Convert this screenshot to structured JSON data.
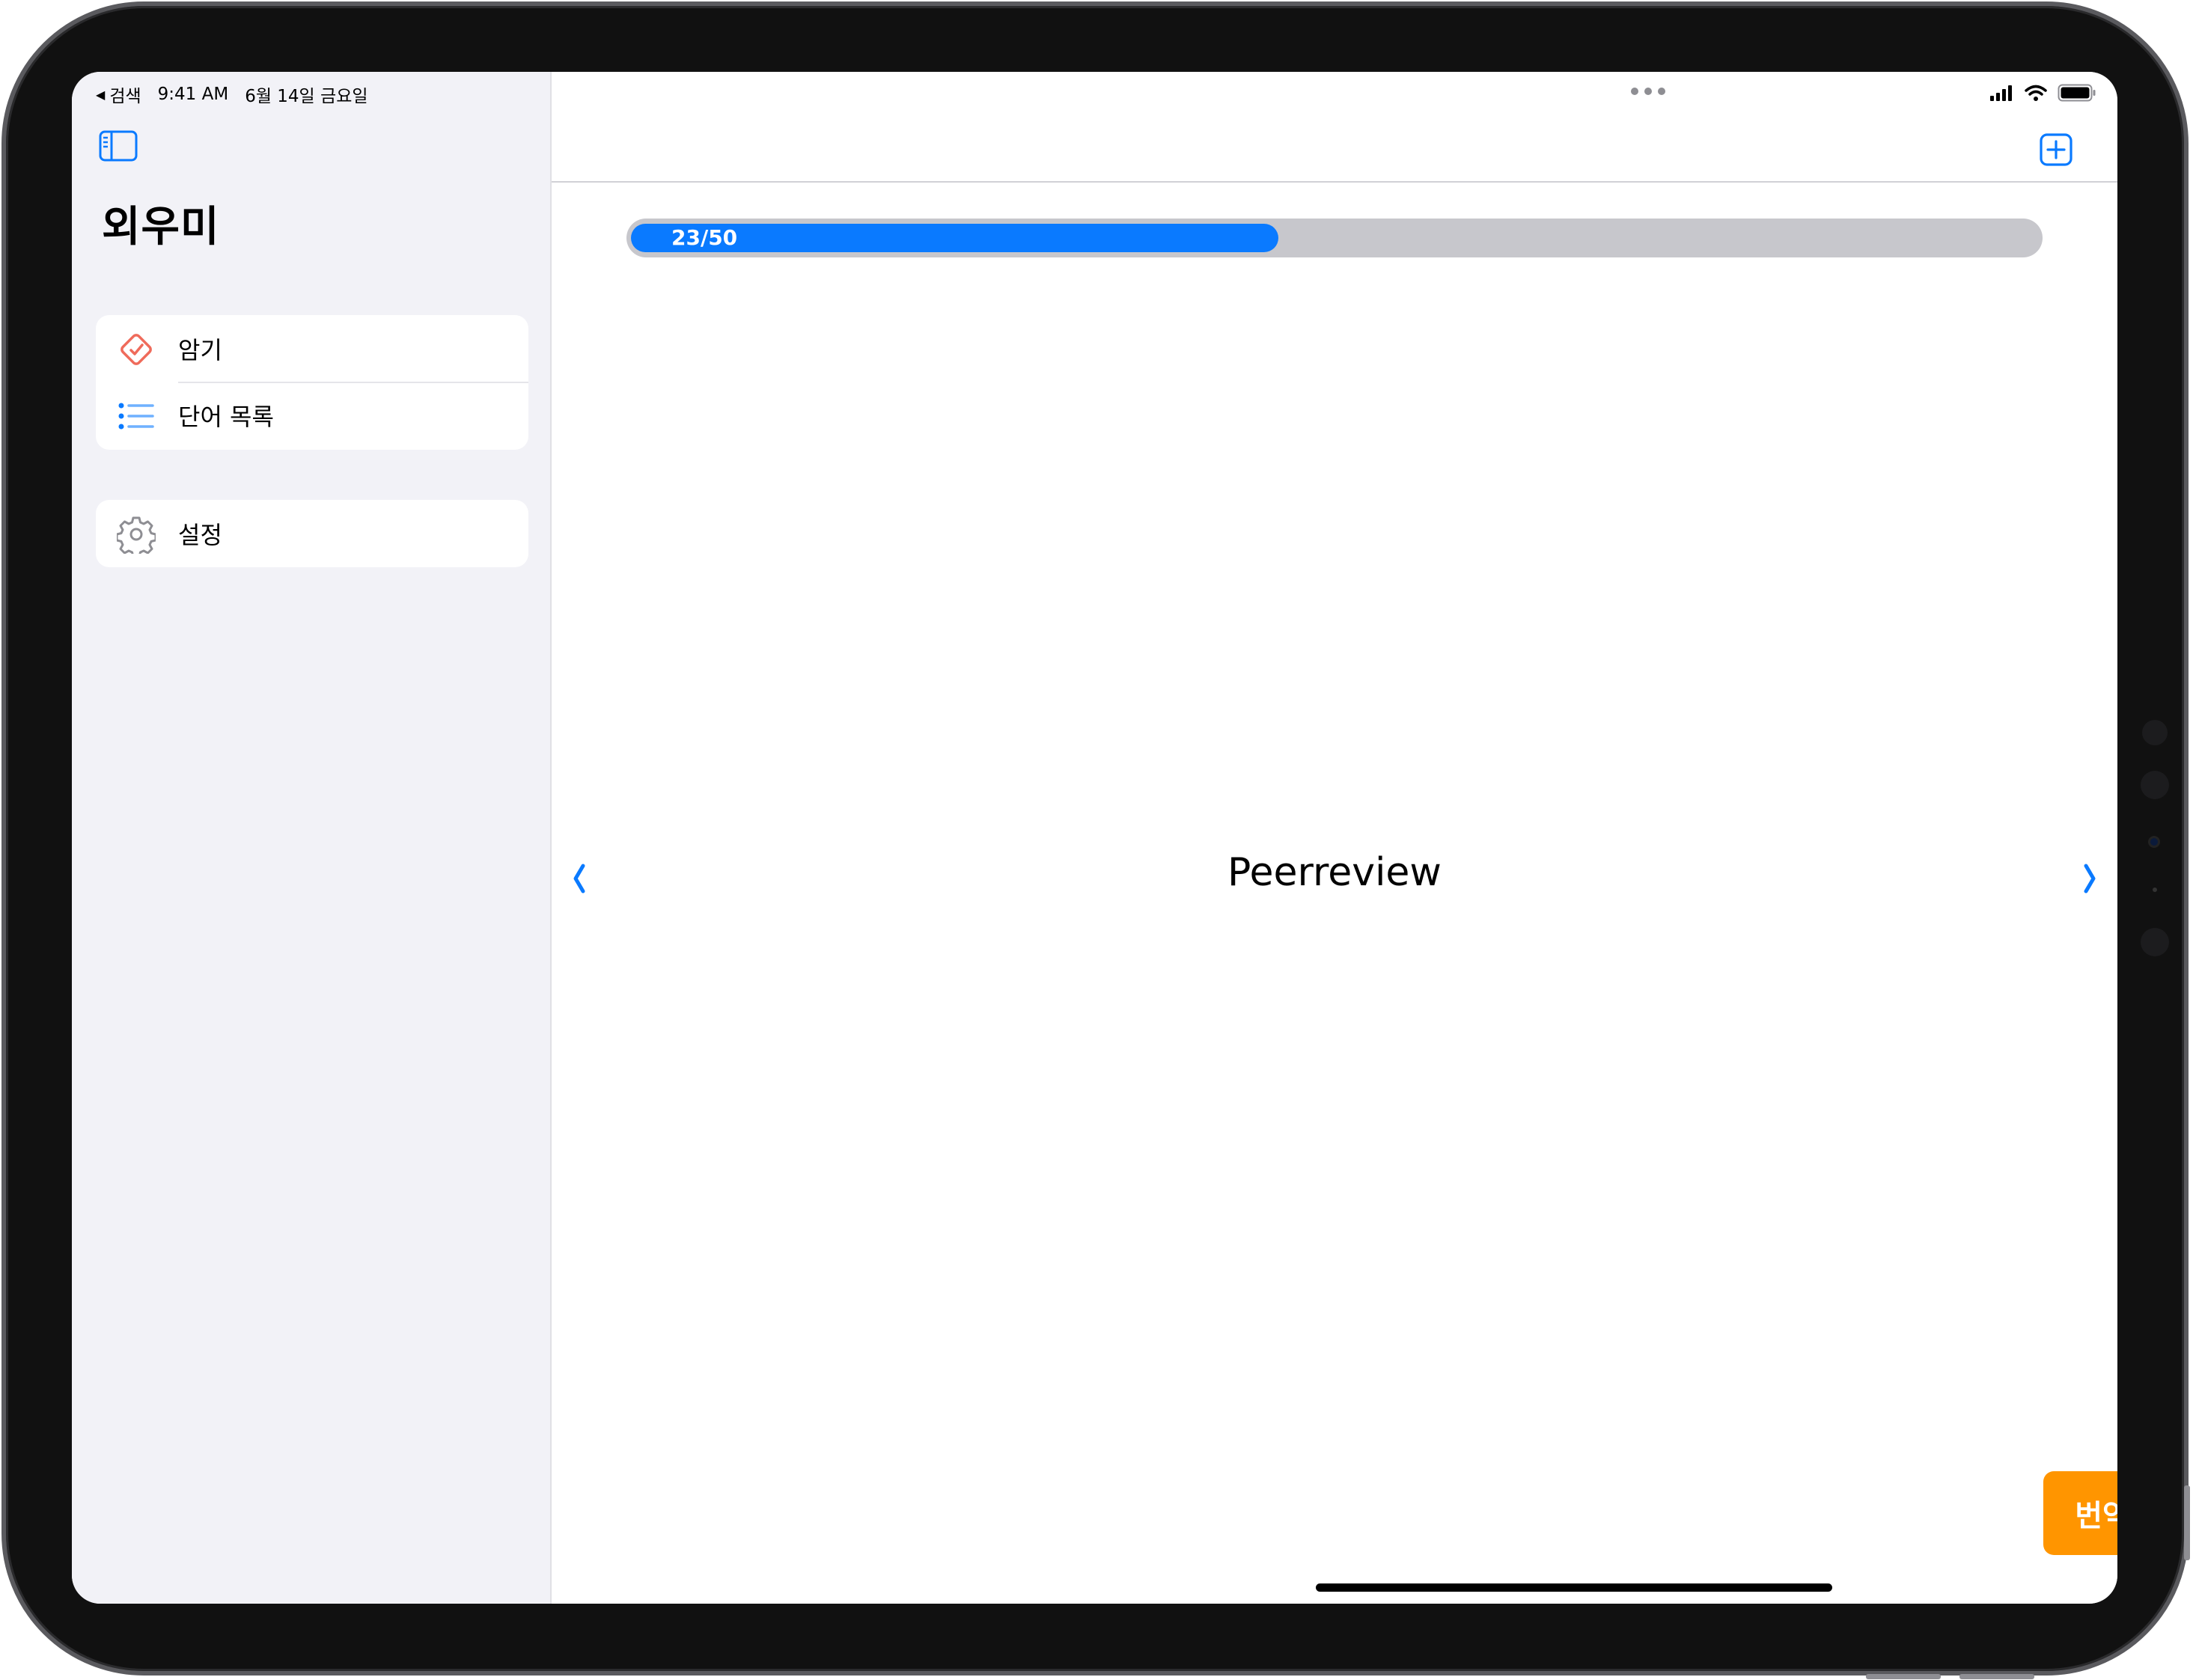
{
  "status_bar": {
    "back_label": "검색",
    "time": "9:41 AM",
    "date": "6월 14일 금요일"
  },
  "sidebar": {
    "title": "외우미",
    "groups": [
      {
        "items": [
          {
            "label": "암기",
            "icon": "checkmark-diamond-icon"
          },
          {
            "label": "단어 목록",
            "icon": "list-bullet-icon"
          }
        ]
      },
      {
        "items": [
          {
            "label": "설정",
            "icon": "gear-icon"
          }
        ]
      }
    ]
  },
  "main": {
    "progress": {
      "current": 23,
      "total": 50,
      "label": "23/50"
    },
    "word": "Peerreview",
    "translate_label": "번역"
  },
  "colors": {
    "accent": "#0a7aff",
    "translate_button": "#ff9500",
    "sidebar_bg": "#f2f2f7",
    "diamond_icon": "#ef6b5b",
    "gear_icon": "#8e8e93"
  }
}
